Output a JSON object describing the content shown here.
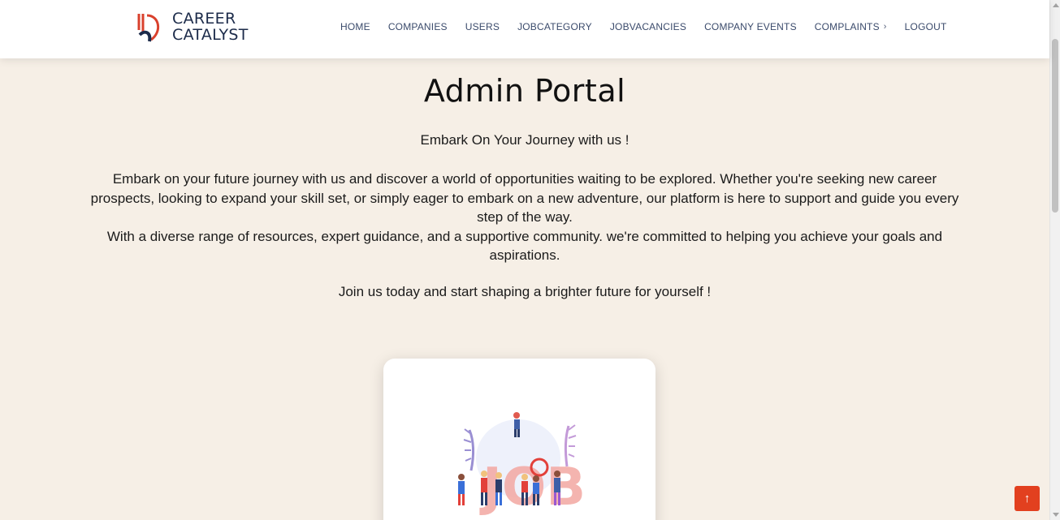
{
  "brand": {
    "line1": "CAREER",
    "line2": "CATALYST"
  },
  "nav": {
    "items": [
      "HOME",
      "COMPANIES",
      "USERS",
      "JOBCATEGORY",
      "JOBVACANCIES",
      "COMPANY EVENTS",
      "COMPLAINTS",
      "LOGOUT"
    ],
    "dropdown_icon": "chevron-right-icon"
  },
  "main": {
    "title": "Admin Portal",
    "subtitle": "Embark On Your Journey with us !",
    "paragraph1": "Embark on your future journey with us and discover a world of opportunities waiting to be explored. Whether you're seeking new career prospects, looking to expand your skill set, or simply eager to embark on a new adventure, our platform is here to support and guide you every step of the way.",
    "paragraph2": "With a diverse range of resources, expert guidance, and a supportive community. we're committed to helping you achieve your goals and aspirations.",
    "cta": "Join us today and start shaping a brighter future for yourself !"
  },
  "illustration": {
    "icon": "job-illustration"
  },
  "back_to_top": {
    "icon": "arrow-up-icon",
    "glyph": "↑"
  },
  "colors": {
    "background": "#f6efe6",
    "accent": "#e2401f",
    "nav_text": "#3a4a6b",
    "brand": "#1c2b4a"
  }
}
